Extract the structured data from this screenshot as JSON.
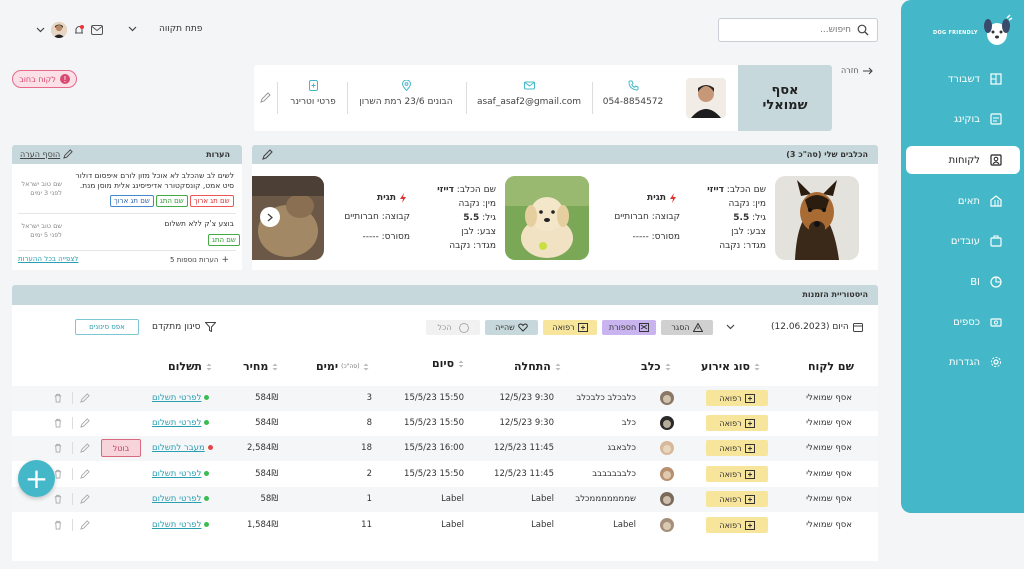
{
  "sidebar": {
    "logo_text": "DOG FRIENDLY",
    "items": [
      {
        "label": "דשבורד",
        "icon": "dashboard-icon"
      },
      {
        "label": "בוקינג",
        "icon": "booking-icon"
      },
      {
        "label": "לקוחות",
        "icon": "customers-icon"
      },
      {
        "label": "תאים",
        "icon": "cells-icon"
      },
      {
        "label": "עובדים",
        "icon": "employees-icon"
      },
      {
        "label": "BI",
        "icon": "bi-icon"
      },
      {
        "label": "כספים",
        "icon": "money-icon"
      },
      {
        "label": "הגדרות",
        "icon": "settings-icon"
      }
    ]
  },
  "header": {
    "search_placeholder": "חיפוש...",
    "open_shift": "פתח תקווה"
  },
  "customer": {
    "back": "חזרה",
    "first_name": "אסף",
    "last_name": "שמואלי",
    "phone": "054-8854572",
    "email": "asaf_asaf2@gmail.com",
    "address": "הבונים 23/6 רמת השרון",
    "vet": "פרטי וטרינר",
    "debt_badge": "לקוח בחוב"
  },
  "dogs_panel": {
    "title": "הכלבים שלי (סה\"כ 3)",
    "dogs": [
      {
        "name_label": "שם הכלב:",
        "name": "דייזי",
        "type": "מין: נקבה",
        "age_label": "גיל:",
        "age": "5.5",
        "color": "צבע: לבן",
        "gender": "מגדר: נקבה",
        "tag": "תגית",
        "group": "קבוצה: חברותיים",
        "cast": "מסורס: -----"
      },
      {
        "name_label": "שם הכלב:",
        "name": "דייזי",
        "type": "מין: נקבה",
        "age_label": "גיל:",
        "age": "5.5",
        "color": "צבע: לבן",
        "gender": "מגדר: נקבה",
        "tag": "תגית",
        "group": "קבוצה: חברותיים",
        "cast": "מסורס: -----"
      }
    ]
  },
  "notes_panel": {
    "title": "הערות",
    "add": "הוסף הערה",
    "note1_text": "לשים לב שהכלב לא אוכל מזון לורם איפסום דולור סיט אמט, קונסקטורר אדיפיסינג אלית מוסן מנת.",
    "note1_meta1": "שם טוב ישראל",
    "note1_meta2": "לפני 3 ימים",
    "note1_tags": [
      "שם תג ארוך",
      "שם התג",
      "שם תג ארוך"
    ],
    "note2_text": "בוצע צ'ק ללא תשלום",
    "note2_meta1": "שם טוב ישראל",
    "note2_meta2": "לפני 5 ימים",
    "note2_tags": [
      "שם התג"
    ],
    "more": "5 הערות נוספות",
    "all": "לצפייה בכל ההערות"
  },
  "history": {
    "title": "היסטוריית הזמנות",
    "today": "היום (12.06.2023)",
    "filters": {
      "warn": "הסגר",
      "supply": "חספורת",
      "stay": "שהייה",
      "meds": "רפואה",
      "all": "הכל"
    },
    "advanced_filter": "סינון מתקדם",
    "reset": "אפס סינונים",
    "columns": {
      "customer": "שם לקוח",
      "event": "סוג אירוע",
      "dog": "כלב",
      "start": "התחלה",
      "end": "סיום",
      "days": "ימים",
      "days_sub": "(סה\"כ)",
      "price": "מחיר",
      "payment": "תשלום"
    },
    "rows": [
      {
        "customer": "אסף שמואלי",
        "event": "רפואה",
        "dog": "כלבכלב כלבכלב",
        "start": "12/5/23 9:30",
        "end": "15/5/23 15:50",
        "days": "3",
        "price": "584₪",
        "payment": "לפרטי תשלום",
        "status": "green",
        "cancel": ""
      },
      {
        "customer": "אסף שמואלי",
        "event": "רפואה",
        "dog": "כלב",
        "start": "12/5/23 9:30",
        "end": "15/5/23 15:50",
        "days": "8",
        "price": "584₪",
        "payment": "לפרטי תשלום",
        "status": "green",
        "cancel": ""
      },
      {
        "customer": "אסף שמואלי",
        "event": "רפואה",
        "dog": "כלבאבג",
        "start": "12/5/23 11:45",
        "end": "15/5/23 16:00",
        "days": "18",
        "price": "2,584₪",
        "payment": "מעבר לתשלום",
        "status": "red",
        "cancel": "בוטל"
      },
      {
        "customer": "אסף שמואלי",
        "event": "רפואה",
        "dog": "כלבבבבבבב",
        "start": "12/5/23 11:45",
        "end": "15/5/23 15:50",
        "days": "2",
        "price": "584₪",
        "payment": "לפרטי תשלום",
        "status": "green",
        "cancel": ""
      },
      {
        "customer": "אסף שמואלי",
        "event": "רפואה",
        "dog": "שמממממממכלב",
        "start": "Label",
        "end": "Label",
        "days": "1",
        "price": "58₪",
        "payment": "לפרטי תשלום",
        "status": "green",
        "cancel": ""
      },
      {
        "customer": "אסף שמואלי",
        "event": "רפואה",
        "dog": "Label",
        "start": "Label",
        "end": "Label",
        "days": "11",
        "price": "1,584₪",
        "payment": "לפרטי תשלום",
        "status": "green",
        "cancel": ""
      }
    ]
  },
  "colors": {
    "accent": "#44b8c8",
    "panel": "#c7d8dc",
    "debt": "#d84a70"
  }
}
